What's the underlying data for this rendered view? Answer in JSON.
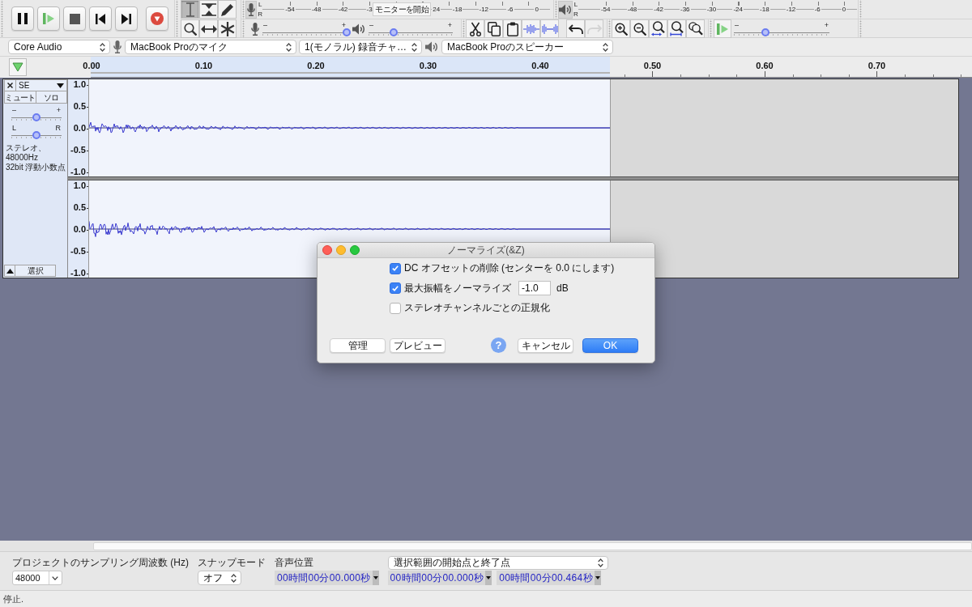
{
  "tools": [
    {
      "kind": "select",
      "selected": true
    },
    {
      "kind": "envelope",
      "selected": false
    },
    {
      "kind": "draw",
      "selected": false
    },
    {
      "kind": "zoom",
      "selected": false
    },
    {
      "kind": "timeshift",
      "selected": false
    },
    {
      "kind": "multi",
      "selected": false
    }
  ],
  "recording_meter": {
    "channels": [
      "L",
      "R"
    ],
    "scale": [
      "-54",
      "-48",
      "-42",
      "-3"
    ],
    "tooltip": "モニターを開始",
    "scale_continued": [
      "24",
      "-18",
      "-12",
      "-6",
      "0"
    ]
  },
  "playback_meter": {
    "channels": [
      "L",
      "R"
    ],
    "scale": [
      "-54",
      "-48",
      "-42",
      "-36",
      "-30",
      "-24",
      "-18",
      "-12",
      "-6",
      "0"
    ]
  },
  "mixer": {
    "recording_volume": {
      "min_label": "–",
      "max_label": "+",
      "level": 1.0
    },
    "playback_volume": {
      "min_label": "–",
      "max_label": "+",
      "level": 0.3
    }
  },
  "edit_toolbar": [
    {
      "kind": "cut",
      "disabled": false
    },
    {
      "kind": "copy",
      "disabled": false
    },
    {
      "kind": "paste",
      "disabled": false
    },
    {
      "kind": "trim",
      "disabled": false
    },
    {
      "kind": "silence",
      "disabled": false
    },
    {
      "kind": "undo",
      "disabled": false
    },
    {
      "kind": "redo",
      "disabled": true
    }
  ],
  "play_at_speed": {
    "min_label": "–",
    "max_label": "+",
    "level": 0.33
  },
  "device_toolbar": {
    "host": "Core Audio",
    "recording_device": "MacBook Proのマイク",
    "recording_channels": "1(モノラル) 録音チャ…",
    "playback_device": "MacBook Proのスピーカー"
  },
  "timeline": {
    "labels": [
      "0.00",
      "0.10",
      "0.20",
      "0.30",
      "0.40",
      "0.50",
      "0.60",
      "0.70"
    ]
  },
  "track": {
    "name": "SE",
    "mute": "ミュート",
    "solo": "ソロ",
    "gain": {
      "min_label": "–",
      "max_label": "+",
      "level": 0.5
    },
    "pan": {
      "min_label": "L",
      "max_label": "R",
      "level": 0.5
    },
    "info": [
      "ステレオ、48000Hz",
      "32bit 浮動小数点"
    ],
    "select_button": "選択",
    "channels": [
      {
        "ruler": [
          "1.0",
          "0.5",
          "0.0",
          "-0.5",
          "-1.0"
        ]
      },
      {
        "ruler": [
          "1.0",
          "0.5",
          "0.0",
          "-0.5",
          "-1.0"
        ]
      }
    ]
  },
  "dialog": {
    "title": "ノーマライズ(&Z)",
    "options": [
      {
        "label": "DC オフセットの削除 (センターを 0.0 にします)",
        "checked": true
      },
      {
        "label": "最大振幅をノーマライズ",
        "checked": true,
        "field": {
          "value": "-1.0",
          "unit": "dB"
        }
      },
      {
        "label": "ステレオチャンネルごとの正規化",
        "checked": false
      }
    ],
    "buttons_left": [
      "管理",
      "プレビュー"
    ],
    "help": "?",
    "buttons_right": [
      {
        "label": "キャンセル",
        "default": false
      },
      {
        "label": "OK",
        "default": true
      }
    ]
  },
  "selection_toolbar": {
    "rate_label": "プロジェクトのサンプリング周波数 (Hz)",
    "rate": "48000",
    "snap_label": "スナップモード",
    "snap": "オフ",
    "position_label": "音声位置",
    "position": "00時間00分00.000秒",
    "selection_mode": "選択範囲の開始点と終了点",
    "selection_start": "00時間00分00.000秒",
    "selection_end": "00時間00分00.464秒"
  },
  "status_bar": "停止."
}
